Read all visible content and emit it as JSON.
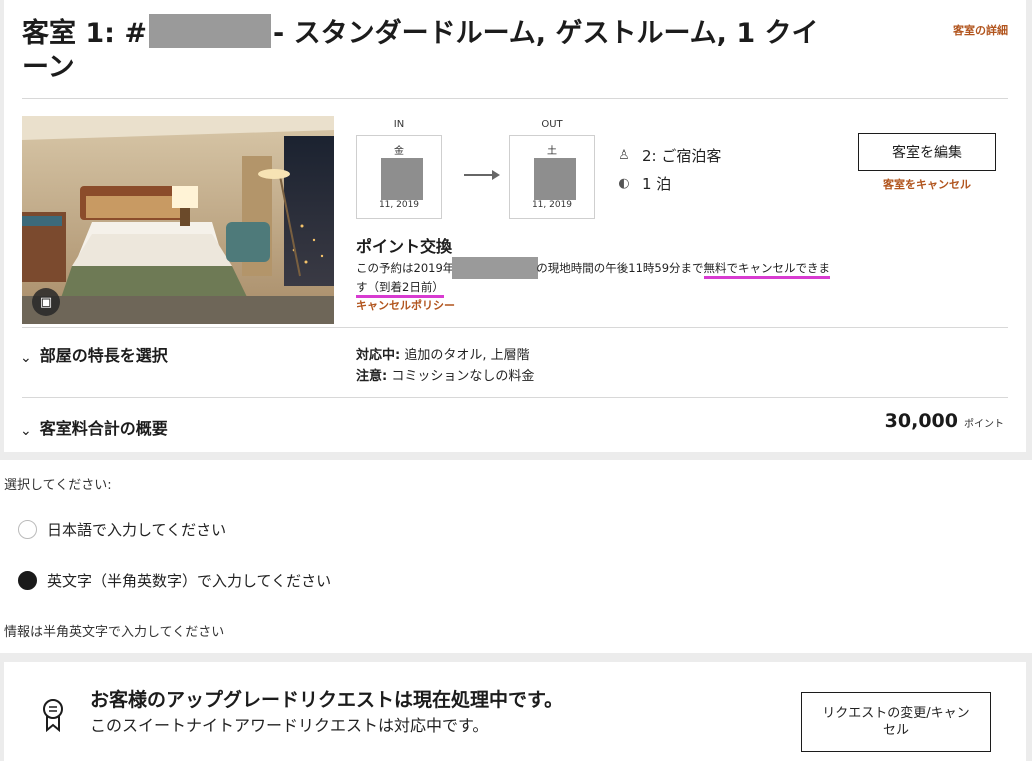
{
  "room": {
    "title_prefix": "客室 1: #",
    "title_suffix": "- スタンダードルーム, ゲストルーム, 1 クイーン",
    "details_link": "客室の詳細"
  },
  "stay": {
    "in_label": "IN",
    "out_label": "OUT",
    "checkin_dow": "金",
    "checkout_dow": "土",
    "checkin_year": "11, 2019",
    "checkout_year": "11, 2019",
    "guests": "2: ご宿泊客",
    "nights": "1 泊"
  },
  "actions": {
    "edit_room": "客室を編集",
    "cancel_room": "客室をキャンセル"
  },
  "rate": {
    "heading": "ポイント交換",
    "policy_part1": "この予約は2019年",
    "policy_part2": "の現地時間の午後11時59分まで",
    "policy_part3": "無料でキャンセルできま",
    "policy_part4": "す（到着2日前）",
    "policy_link": "キャンセルポリシー"
  },
  "features": {
    "heading": "部屋の特長を選択",
    "line1_label": "対応中:",
    "line1_value": " 追加のタオル, 上層階",
    "line2_label": "注意:",
    "line2_value": " コミッションなしの料金"
  },
  "summary": {
    "heading": "客室料合計の概要",
    "total": "30,000",
    "unit": "ポイント"
  },
  "input_mode": {
    "label": "選択してください:",
    "option_ja": "日本語で入力してください",
    "option_en": "英文字（半角英数字）で入力してください",
    "selected": "en",
    "hint": "情報は半角英文字で入力してください"
  },
  "upgrade": {
    "title": "お客様のアップグレードリクエストは現在処理中です。",
    "subtitle": "このスイートナイトアワードリクエストは対応中です。",
    "button": "リクエストの変更/キャンセル"
  },
  "colors": {
    "accent": "#b1541d",
    "underline": "#d83bd1"
  }
}
